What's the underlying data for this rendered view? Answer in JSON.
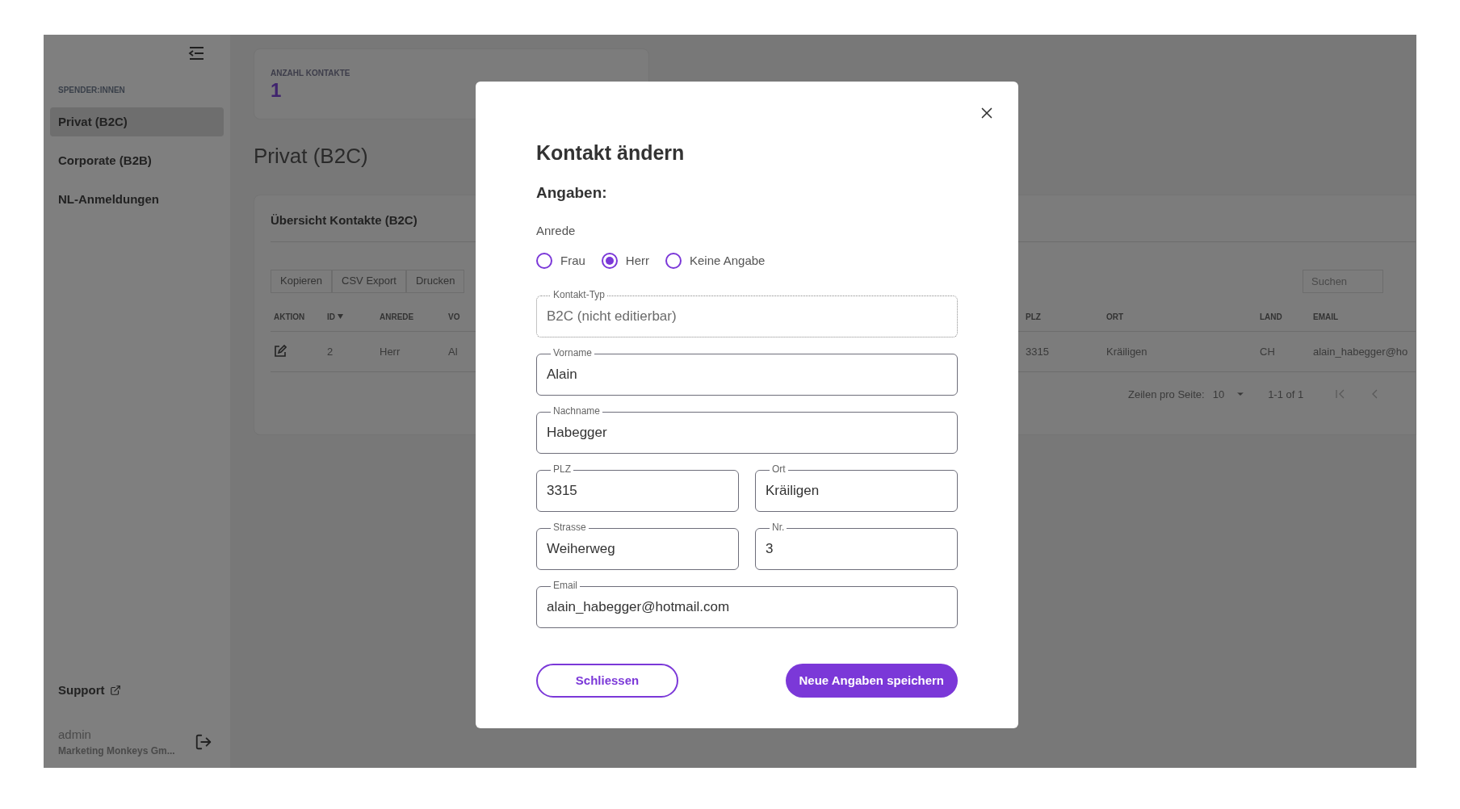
{
  "sidebar": {
    "section_label": "SPENDER:INNEN",
    "items": [
      {
        "label": "Privat (B2C)",
        "selected": true
      },
      {
        "label": "Corporate (B2B)",
        "selected": false
      },
      {
        "label": "NL-Anmeldungen",
        "selected": false
      }
    ],
    "support": "Support",
    "user": {
      "name": "admin",
      "company": "Marketing Monkeys Gm..."
    }
  },
  "stats_card": {
    "label": "ANZAHL KONTAKTE",
    "value": "1"
  },
  "page_title": "Privat (B2C)",
  "table_card": {
    "title": "Übersicht Kontakte (B2C)",
    "toolbar": [
      "Kopieren",
      "CSV Export",
      "Drucken"
    ],
    "search": {
      "placeholder": "Suchen"
    },
    "columns": [
      {
        "label": "AKTION",
        "sorted": false
      },
      {
        "label": "ID",
        "sorted": true
      },
      {
        "label": "ANREDE",
        "sorted": false
      },
      {
        "label": "VO",
        "sorted": false
      },
      {
        "label": "PLZ",
        "sorted": false
      },
      {
        "label": "ORT",
        "sorted": false
      },
      {
        "label": "LAND",
        "sorted": false
      },
      {
        "label": "EMAIL",
        "sorted": false
      }
    ],
    "rows": [
      {
        "cells": [
          "",
          "2",
          "Herr",
          "Al",
          "3315",
          "Kräiligen",
          "CH",
          "alain_habegger@ho"
        ]
      }
    ],
    "pagination": {
      "rows_label": "Zeilen pro Seite:",
      "rows_value": "10",
      "range": "1-1 of 1"
    }
  },
  "dialog": {
    "title": "Kontakt ändern",
    "section": "Angaben:",
    "anrede": {
      "label": "Anrede",
      "options": [
        {
          "label": "Frau",
          "selected": false
        },
        {
          "label": "Herr",
          "selected": true
        },
        {
          "label": "Keine Angabe",
          "selected": false
        }
      ]
    },
    "field_rows": [
      [
        {
          "label": "Kontakt-Typ",
          "value": "B2C (nicht editierbar)",
          "disabled": true
        }
      ],
      [
        {
          "label": "Vorname",
          "value": "Alain",
          "disabled": false
        }
      ],
      [
        {
          "label": "Nachname",
          "value": "Habegger",
          "disabled": false
        }
      ],
      [
        {
          "label": "PLZ",
          "value": "3315",
          "disabled": false
        },
        {
          "label": "Ort",
          "value": "Kräiligen",
          "disabled": false
        }
      ],
      [
        {
          "label": "Strasse",
          "value": "Weiherweg",
          "disabled": false
        },
        {
          "label": "Nr.",
          "value": "3",
          "disabled": false
        }
      ],
      [
        {
          "label": "Email",
          "value": "alain_habegger@hotmail.com",
          "disabled": false
        }
      ]
    ],
    "buttons": [
      {
        "label": "Schliessen",
        "kind": "secondary"
      },
      {
        "label": "Neue Angaben speichern",
        "kind": "primary"
      }
    ]
  }
}
